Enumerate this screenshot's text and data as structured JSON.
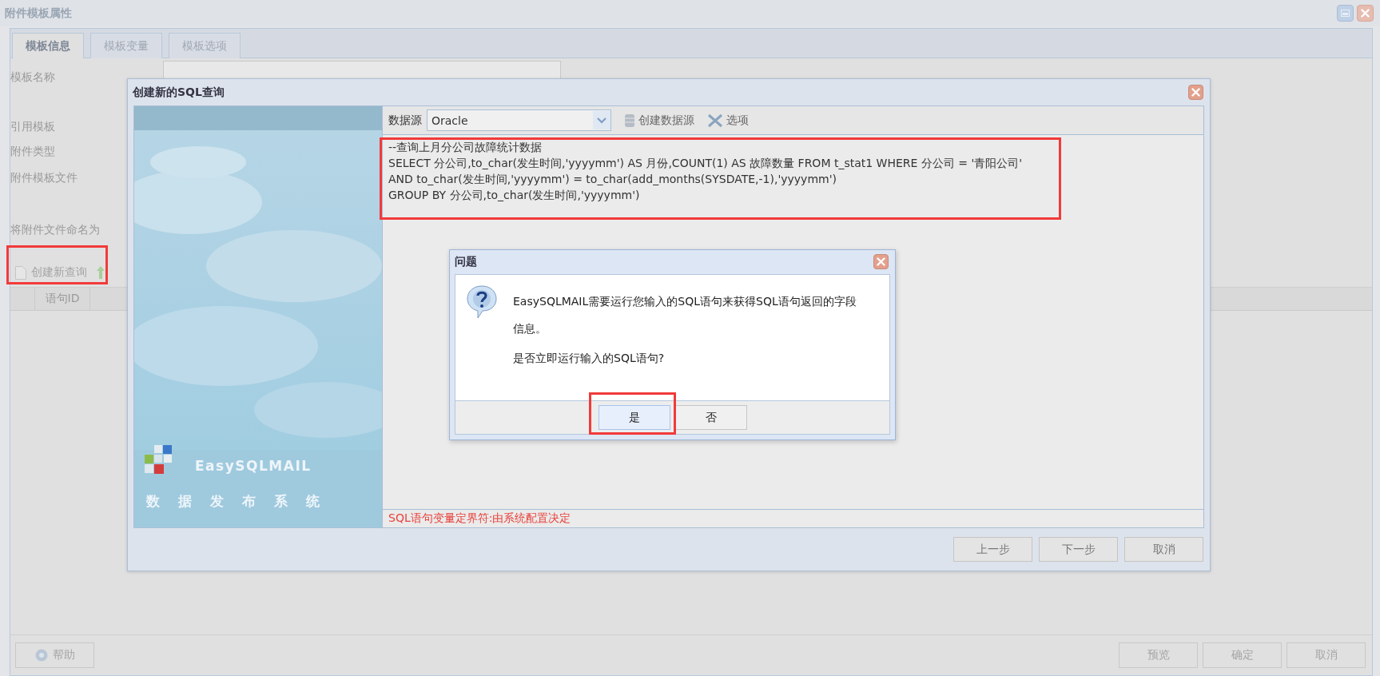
{
  "window": {
    "title": "附件模板属性"
  },
  "tabs": [
    {
      "label": "模板信息",
      "selected": true
    },
    {
      "label": "模板变量",
      "selected": false
    },
    {
      "label": "模板选项",
      "selected": false
    }
  ],
  "form": [
    {
      "label": "模板名称",
      "kind": "input"
    },
    {
      "label": "引用模板",
      "kind": "label"
    },
    {
      "label": "附件类型",
      "kind": "label"
    },
    {
      "label": "附件模板文件",
      "kind": "label"
    },
    {
      "label": "将附件文件命名为",
      "kind": "label"
    }
  ],
  "query_toolbar": {
    "create_button": "创建新查询"
  },
  "query_table": {
    "columns": [
      "语句ID"
    ]
  },
  "footer": {
    "help_button": "帮助",
    "buttons": [
      "预览",
      "确定",
      "取消"
    ]
  },
  "sql_dialog": {
    "title": "创建新的SQL查询",
    "banner": {
      "product": "EasySQLMAIL",
      "tagline": "数据发布系统"
    },
    "datasource": {
      "label": "数据源",
      "value": "Oracle"
    },
    "tools": [
      {
        "label": "创建数据源",
        "kind": "datasource"
      },
      {
        "label": "选项",
        "kind": "options"
      }
    ],
    "sql_lines": [
      "--查询上月分公司故障统计数据",
      "SELECT 分公司,to_char(发生时间,'yyyymm') AS 月份,COUNT(1) AS 故障数量 FROM t_stat1 WHERE 分公司 = '青阳公司'",
      "AND to_char(发生时间,'yyyymm') = to_char(add_months(SYSDATE,-1),'yyyymm')",
      "GROUP BY 分公司,to_char(发生时间,'yyyymm')"
    ],
    "delimiter_note": "SQL语句变量定界符:由系统配置决定",
    "buttons": [
      "上一步",
      "下一步",
      "取消"
    ]
  },
  "question_dialog": {
    "title": "问题",
    "message": [
      "EasySQLMAIL需要运行您输入的SQL语句来获得SQL语句返回的字段信息。",
      "是否立即运行输入的SQL语句?"
    ],
    "buttons": [
      {
        "label": "是",
        "selected": true
      },
      {
        "label": "否",
        "selected": false
      }
    ]
  }
}
